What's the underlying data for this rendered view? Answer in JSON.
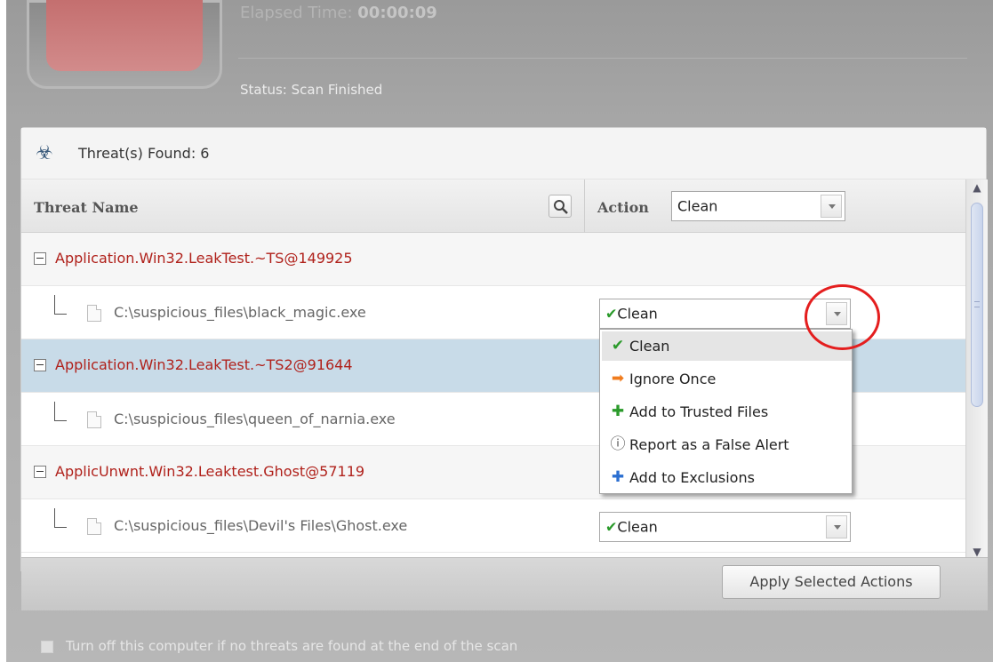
{
  "header": {
    "elapsed_label": "Elapsed Time:",
    "elapsed_value": "00:00:09",
    "status": "Status: Scan Finished"
  },
  "threats": {
    "title": "Threat(s) Found: 6",
    "icon": "biohazard-icon"
  },
  "columns": {
    "threat_name": "Threat Name",
    "action": "Action",
    "action_selected": "Clean"
  },
  "rows": [
    {
      "type": "group",
      "name": "Application.Win32.LeakTest.~TS@149925"
    },
    {
      "type": "file",
      "path": "C:\\suspicious_files\\black_magic.exe",
      "action": "Clean"
    },
    {
      "type": "group",
      "name": "Application.Win32.LeakTest.~TS2@91644"
    },
    {
      "type": "file",
      "path": "C:\\suspicious_files\\queen_of_narnia.exe"
    },
    {
      "type": "group",
      "name": "ApplicUnwnt.Win32.Leaktest.Ghost@57119"
    },
    {
      "type": "file",
      "path": "C:\\suspicious_files\\Devil's Files\\Ghost.exe",
      "action": "Clean"
    }
  ],
  "dropdown": {
    "items": [
      {
        "label": "Clean",
        "icon": "check-icon",
        "color": "#2a9a2a"
      },
      {
        "label": "Ignore Once",
        "icon": "arrow-right-icon",
        "color": "#f07c1e"
      },
      {
        "label": "Add to Trusted Files",
        "icon": "plus-icon",
        "color": "#2a9a2a"
      },
      {
        "label": "Report as a False Alert",
        "icon": "info-icon",
        "color": "#555555"
      },
      {
        "label": "Add to Exclusions",
        "icon": "plus-icon",
        "color": "#2b6fd1"
      }
    ]
  },
  "footer": {
    "apply_label": "Apply Selected Actions",
    "shutdown_label": "Turn off this computer if no threats are found at the end of the scan"
  },
  "colors": {
    "threat_red": "#b0211b",
    "selected_row": "#c8dbe8",
    "annotation_red": "#e41e1e"
  }
}
